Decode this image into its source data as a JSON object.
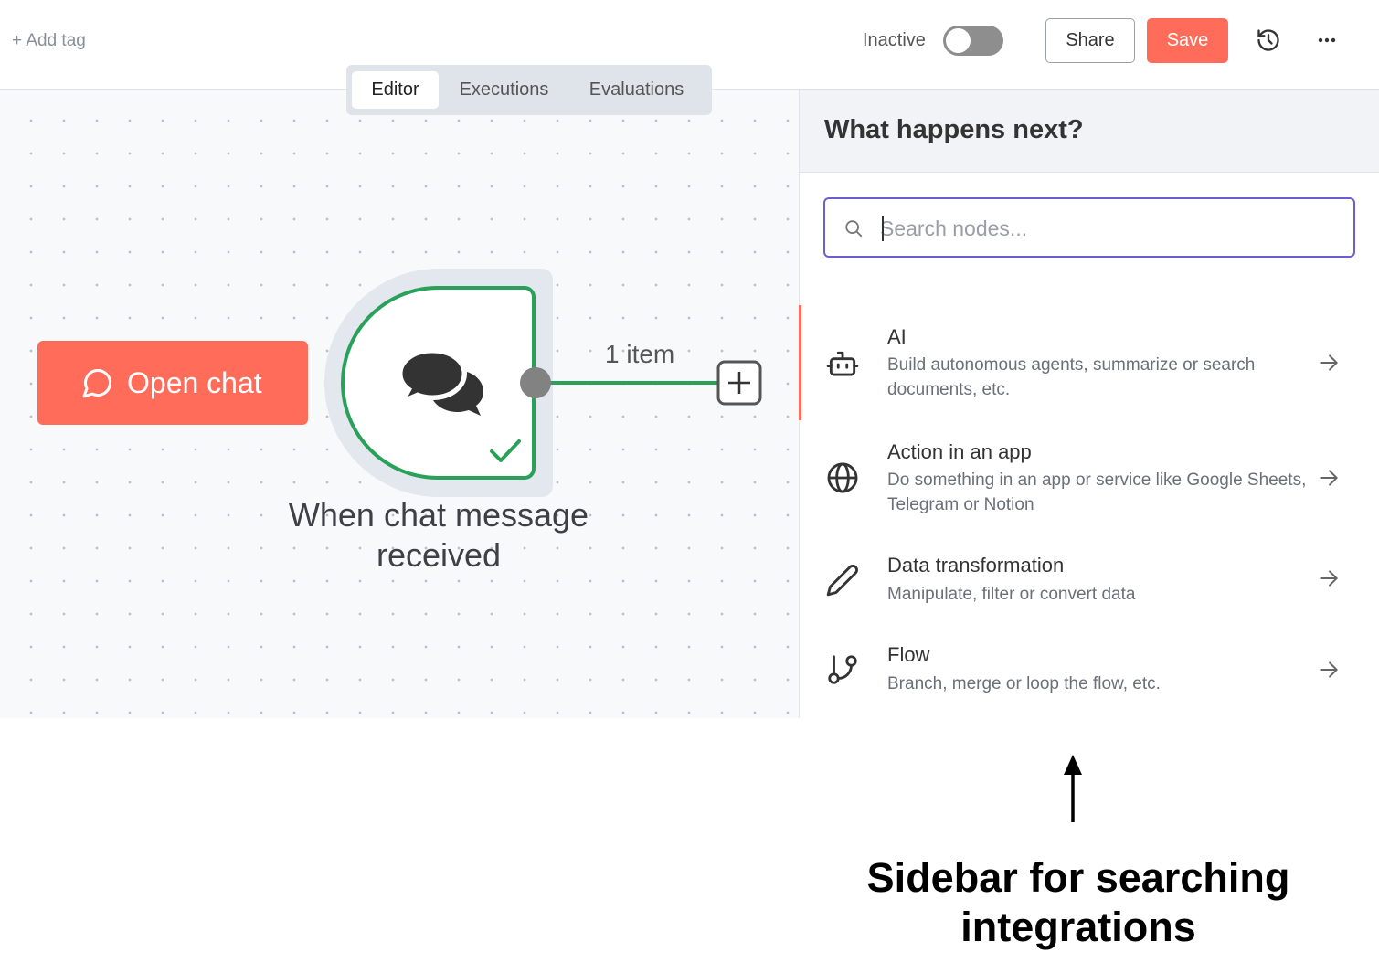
{
  "topbar": {
    "add_tag": "+ Add tag",
    "status_label": "Inactive",
    "share_label": "Share",
    "save_label": "Save"
  },
  "tabs": [
    {
      "label": "Editor",
      "active": true
    },
    {
      "label": "Executions",
      "active": false
    },
    {
      "label": "Evaluations",
      "active": false
    }
  ],
  "canvas": {
    "open_chat_label": "Open chat",
    "node_label": "When chat message received",
    "connection_label": "1 item"
  },
  "sidebar": {
    "title": "What happens next?",
    "search_placeholder": "Search nodes...",
    "categories": [
      {
        "title": "AI",
        "description": "Build autonomous agents, summarize or search documents, etc.",
        "icon": "robot-icon"
      },
      {
        "title": "Action in an app",
        "description": "Do something in an app or service like Google Sheets, Telegram or Notion",
        "icon": "globe-icon"
      },
      {
        "title": "Data transformation",
        "description": "Manipulate, filter or convert data",
        "icon": "pencil-icon"
      },
      {
        "title": "Flow",
        "description": "Branch, merge or loop the flow, etc.",
        "icon": "git-branch-icon"
      }
    ]
  },
  "annotation": {
    "text": "Sidebar for searching integrations"
  },
  "colors": {
    "accent": "#ff6d5a",
    "success": "#2aa15a",
    "search_border": "#6b5fcf"
  }
}
